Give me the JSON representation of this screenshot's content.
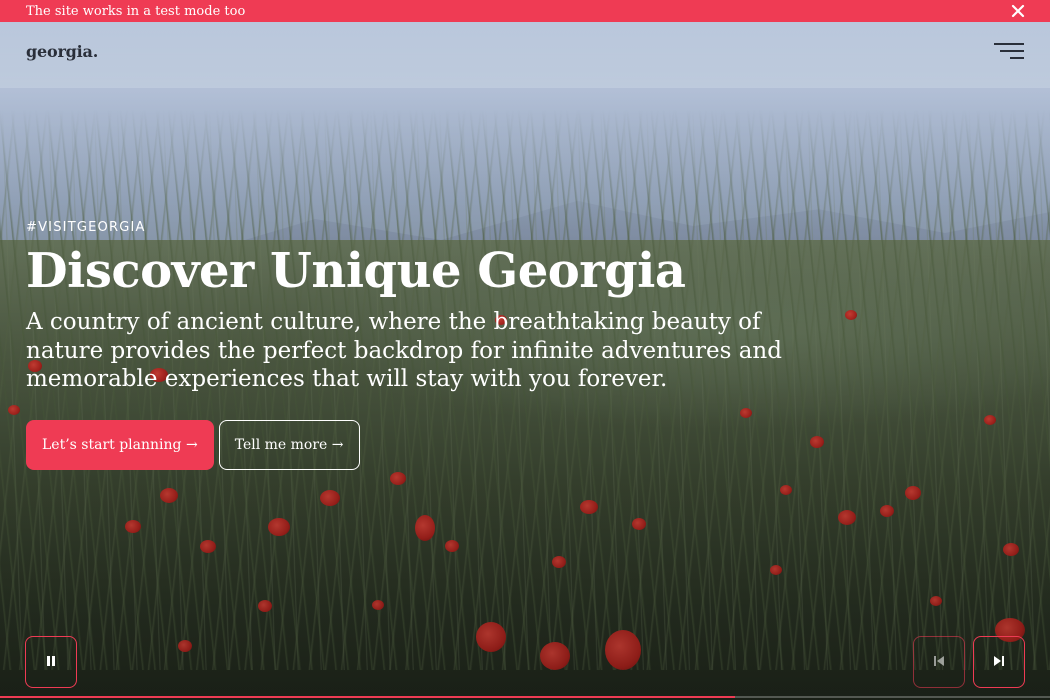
{
  "alert": {
    "text": "The site works in a test mode too",
    "close_icon": "close-icon",
    "color": "#ef3b54"
  },
  "header": {
    "logo": "georgia.",
    "menu_icon": "hamburger-menu-icon"
  },
  "hero": {
    "hashtag": "#VISITGEORGIA",
    "title": "Discover Unique Georgia",
    "description": "A country of ancient culture, where the breathtaking beauty of nature provides the perfect backdrop for infinite adventures and memorable experiences that will stay with you forever.",
    "primary_button": "Let’s start planning →",
    "secondary_button": "Tell me more →"
  },
  "controls": {
    "pause_icon": "pause-icon",
    "prev_icon": "skip-previous-icon",
    "next_icon": "skip-next-icon",
    "progress": 0.7
  },
  "theme": {
    "accent": "#ef3b54"
  }
}
